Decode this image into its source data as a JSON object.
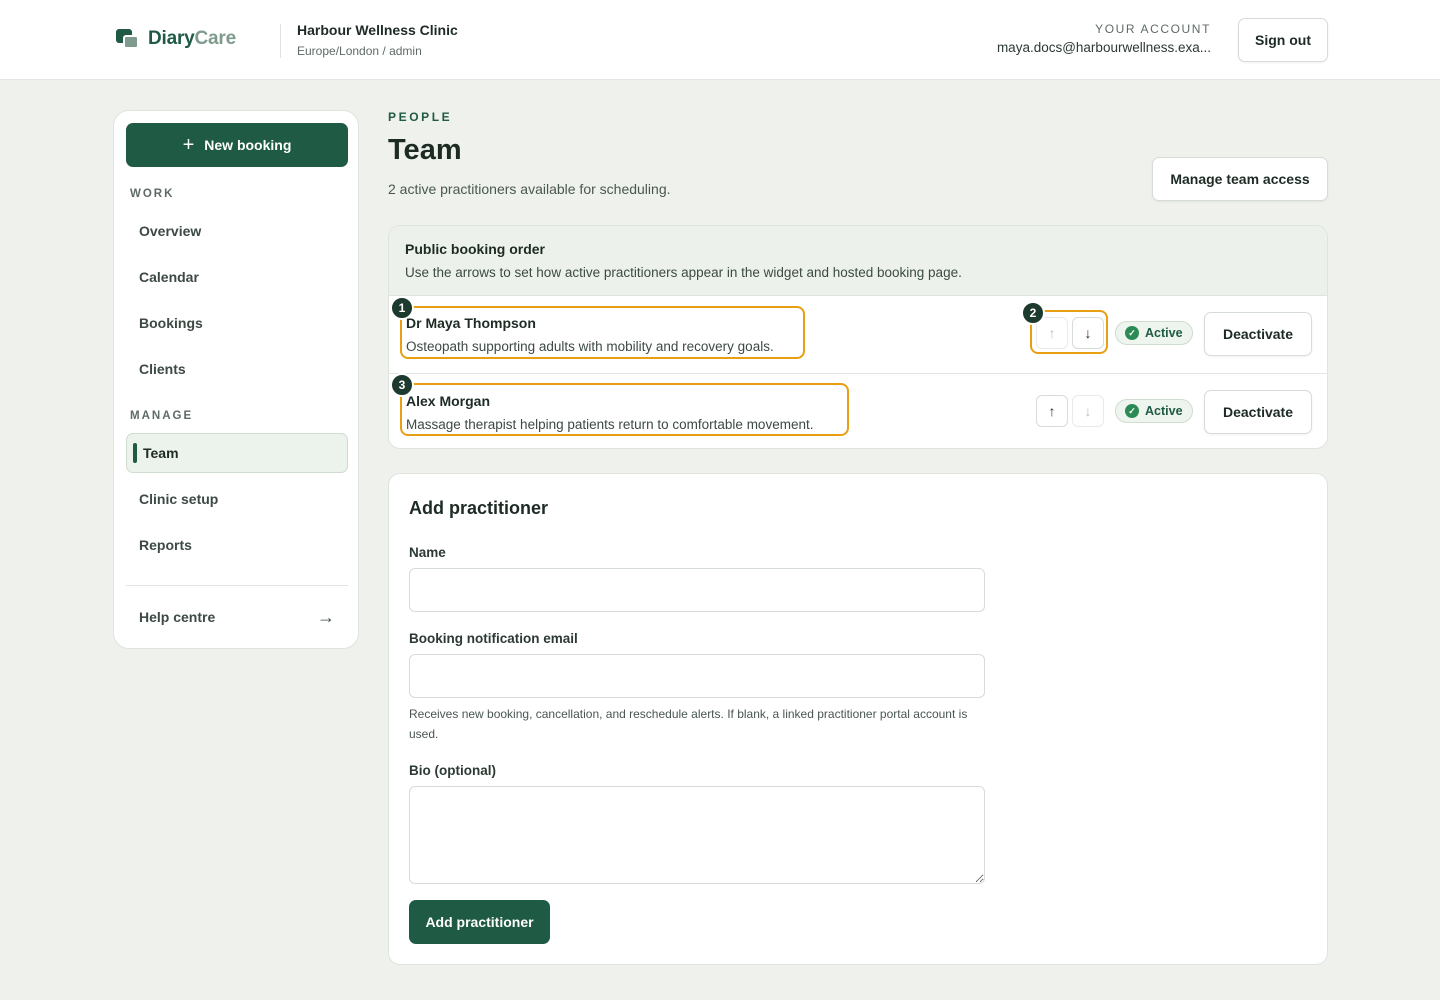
{
  "brand": {
    "name_part1": "Diary",
    "name_part2": "Care"
  },
  "clinic": {
    "name": "Harbour Wellness Clinic",
    "meta": "Europe/London / admin"
  },
  "account": {
    "label": "YOUR ACCOUNT",
    "email": "maya.docs@harbourwellness.exa...",
    "signout_label": "Sign out"
  },
  "sidebar": {
    "new_booking_label": "New booking",
    "work_label": "WORK",
    "work_items": [
      {
        "label": "Overview"
      },
      {
        "label": "Calendar"
      },
      {
        "label": "Bookings"
      },
      {
        "label": "Clients"
      }
    ],
    "manage_label": "MANAGE",
    "manage_items": [
      {
        "label": "Team",
        "active": true
      },
      {
        "label": "Clinic setup"
      },
      {
        "label": "Reports"
      }
    ],
    "help_label": "Help centre"
  },
  "page": {
    "eyebrow": "PEOPLE",
    "title": "Team",
    "subtitle": "2 active practitioners available for scheduling.",
    "manage_access_label": "Manage team access"
  },
  "booking_order": {
    "title": "Public booking order",
    "description": "Use the arrows to set how active practitioners appear in the widget and hosted booking page.",
    "practitioners": [
      {
        "name": "Dr Maya Thompson",
        "bio": "Osteopath supporting adults with mobility and recovery goals.",
        "status": "Active",
        "action_label": "Deactivate",
        "move_up_enabled": false,
        "move_down_enabled": true
      },
      {
        "name": "Alex Morgan",
        "bio": "Massage therapist helping patients return to comfortable movement.",
        "status": "Active",
        "action_label": "Deactivate",
        "move_up_enabled": true,
        "move_down_enabled": false
      }
    ]
  },
  "markers": [
    "1",
    "2",
    "3"
  ],
  "add_practitioner": {
    "title": "Add practitioner",
    "name_label": "Name",
    "name_value": "",
    "email_label": "Booking notification email",
    "email_value": "",
    "email_help": "Receives new booking, cancellation, and reschedule alerts. If blank, a linked practitioner portal account is used.",
    "bio_label": "Bio (optional)",
    "bio_value": "",
    "submit_label": "Add practitioner"
  },
  "colors": {
    "brand": "#1f5a44",
    "highlight": "#e8a012",
    "active_badge": "#2c8a55"
  }
}
